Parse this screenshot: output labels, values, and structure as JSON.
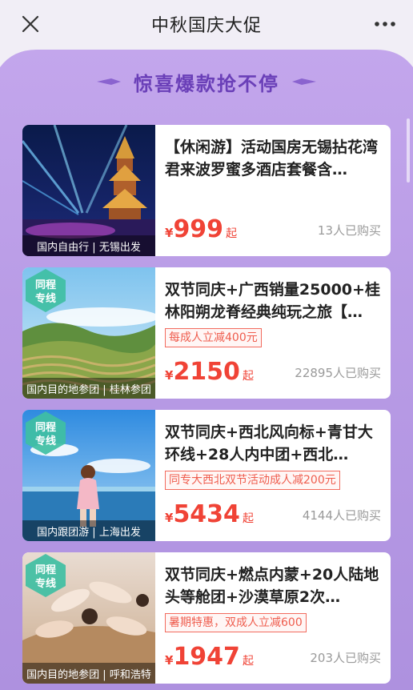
{
  "header": {
    "title": "中秋国庆大促"
  },
  "section": {
    "title": "惊喜爆款抢不停"
  },
  "products": [
    {
      "name": "【休闲游】活动国房无锡拈花湾君来波罗蜜多酒店套餐含…",
      "tag": "",
      "currency": "¥",
      "price": "999",
      "price_suffix": "起",
      "sold": "13人已购买",
      "caption": "国内自由行 | 无锡出发",
      "brand_badge": false
    },
    {
      "name": "双节同庆+广西销量25000+桂林阳朔龙脊经典纯玩之旅【…",
      "tag": "每成人立减400元",
      "currency": "¥",
      "price": "2150",
      "price_suffix": "起",
      "sold": "22895人已购买",
      "caption": "国内目的地参团 | 桂林参团",
      "brand_badge": true
    },
    {
      "name": "双节同庆+西北风向标+青甘大环线+28人内中团+西北…",
      "tag": "同专大西北双节活动成人减200元",
      "currency": "¥",
      "price": "5434",
      "price_suffix": "起",
      "sold": "4144人已购买",
      "caption": "国内跟团游 | 上海出发",
      "brand_badge": true
    },
    {
      "name": "双节同庆+燃点内蒙+20人陆地头等舱团+沙漠草原2次…",
      "tag": "暑期特惠，双成人立减600",
      "currency": "¥",
      "price": "1947",
      "price_suffix": "起",
      "sold": "203人已购买",
      "caption": "国内目的地参团 | 呼和浩特",
      "brand_badge": true
    }
  ],
  "brand_badge_text": [
    "同程",
    "专线"
  ],
  "icons": {
    "close": "close-icon",
    "more": "more-icon"
  },
  "colors": {
    "accent": "#f04336",
    "purple": "#6a3fb8"
  }
}
